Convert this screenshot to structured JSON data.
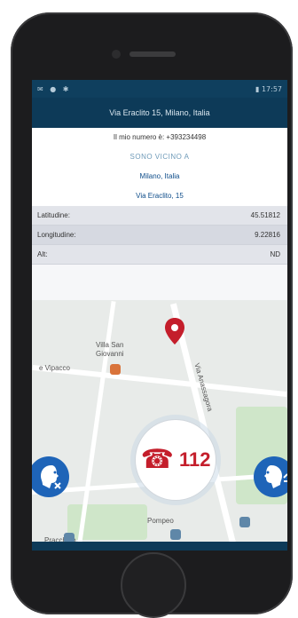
{
  "status": {
    "icons": [
      "msg-icon",
      "notification-icon",
      "settings-icon"
    ],
    "right_indicator": "▮ 17:57"
  },
  "header": {
    "location": "Via Eraclito 15, Milano, Italia"
  },
  "info": {
    "my_number": "Il mio numero è: +393234498",
    "near_label": "SONO VICINO A",
    "city": "Milano, Italia",
    "street": "Via Eraclito, 15"
  },
  "coords": {
    "rows": [
      {
        "label": "Latitudine:",
        "value": "45.51812"
      },
      {
        "label": "Longitudine:",
        "value": "9.22816"
      },
      {
        "label": "Alt:",
        "value": "ND"
      }
    ]
  },
  "map": {
    "labels": {
      "villa": "Villa San Giovanni",
      "vipacco": "e Vipacco",
      "via_anassagora": "Via Anassagora",
      "bus_stop": "Pompeo",
      "bottom_left": "Pracchino"
    }
  },
  "emergency": {
    "number": "112"
  },
  "colors": {
    "accent_blue": "#0d3a58",
    "emergency_red": "#c41e2b",
    "side_button_blue": "#1e64b8"
  }
}
